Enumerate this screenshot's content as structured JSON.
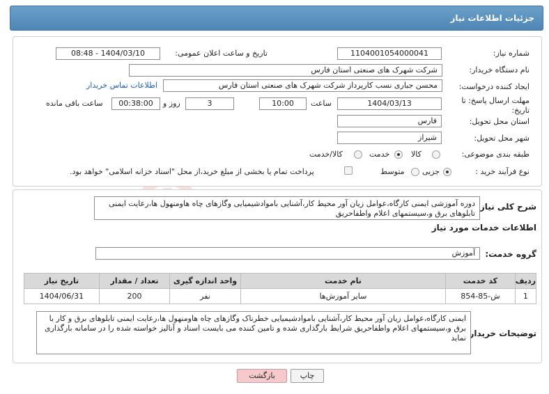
{
  "header": {
    "title": "جزئیات اطلاعات نیاز"
  },
  "fields": {
    "need_number_label": "شماره نیاز:",
    "need_number": "1104001054000041",
    "announce_label": "تاریخ و ساعت اعلان عمومی:",
    "announce_value": "1404/03/10 - 08:48",
    "buyer_label": "نام دستگاه خریدار:",
    "buyer_value": "شرکت شهرک های صنعتی استان فارس",
    "creator_label": "ایجاد کننده درخواست:",
    "creator_value": "محسن  جباری نسب کارپرداز شرکت شهرک های صنعتی استان فارس",
    "contact_link": "اطلاعات تماس خریدار",
    "deadline_label": "مهلت ارسال پاسخ: تا تاریخ:",
    "deadline_date": "1404/03/13",
    "time_label": "ساعت",
    "deadline_time": "10:00",
    "days_value": "3",
    "days_label": "روز و",
    "remain_time": "00:38:00",
    "remain_label": "ساعت باقی مانده",
    "province_label": "استان محل تحویل:",
    "province_value": "فارس",
    "city_label": "شهر محل تحویل:",
    "city_value": "شیراز",
    "category_label": "طبقه بندی موضوعی:",
    "category_options": [
      "کالا",
      "خدمت",
      "کالا/خدمت"
    ],
    "category_selected": "خدمت",
    "process_label": "نوع فرآیند خرید :",
    "process_options": [
      "جزیی",
      "متوسط"
    ],
    "process_selected": "جزیی",
    "payment_note": "پرداخت تمام یا بخشی از مبلغ خرید،از محل \"اسناد خزانه اسلامی\" خواهد بود."
  },
  "description": {
    "label": "شرح کلی نیاز:",
    "text": "دوره آموزشی ایمنی کارگاه،عوامل زیان آور محیط کار،آشنایی بامواد‌شیمیایی وگازهای چاه هاومنهول ها،رعایت ایمنی تابلوهای برق و،سیستمهای اعلام واطفاحریق"
  },
  "services": {
    "section_title": "اطلاعات خدمات مورد نیاز",
    "group_label": "گروه خدمت:",
    "group_value": "آموزش",
    "columns": [
      "ردیف",
      "کد خدمت",
      "نام خدمت",
      "واحد اندازه گیری",
      "تعداد / مقدار",
      "تاریخ نیاز"
    ],
    "rows": [
      [
        "1",
        "ش-85-854",
        "سایر آموزش‌ها",
        "نفر",
        "200",
        "1404/06/31"
      ]
    ]
  },
  "buyer_notes": {
    "label": "توضیحات خریدار:",
    "text": "ایمنی کارگاه،عوامل زیان آور محیط کار،آشنایی باموادشیمیایی خطرناک وگازهای چاه هاومنهول ها،رعایت ایمنی تابلوهای برق و کار با برق و،سیستمهای اعلام واطفاحریق شرایط بارگذاری شده و تامین کننده می بایست اسناد و آنالیز خواسته شده را در سامانه بارگذاری نماید"
  },
  "buttons": {
    "print": "چاپ",
    "back": "بازگشت"
  },
  "watermark": {
    "text": "AriaTender.neT"
  },
  "colors": {
    "header_bg": "#5a8fbb",
    "link": "#1a5fb4",
    "back_btn": "#f6c9cc"
  }
}
